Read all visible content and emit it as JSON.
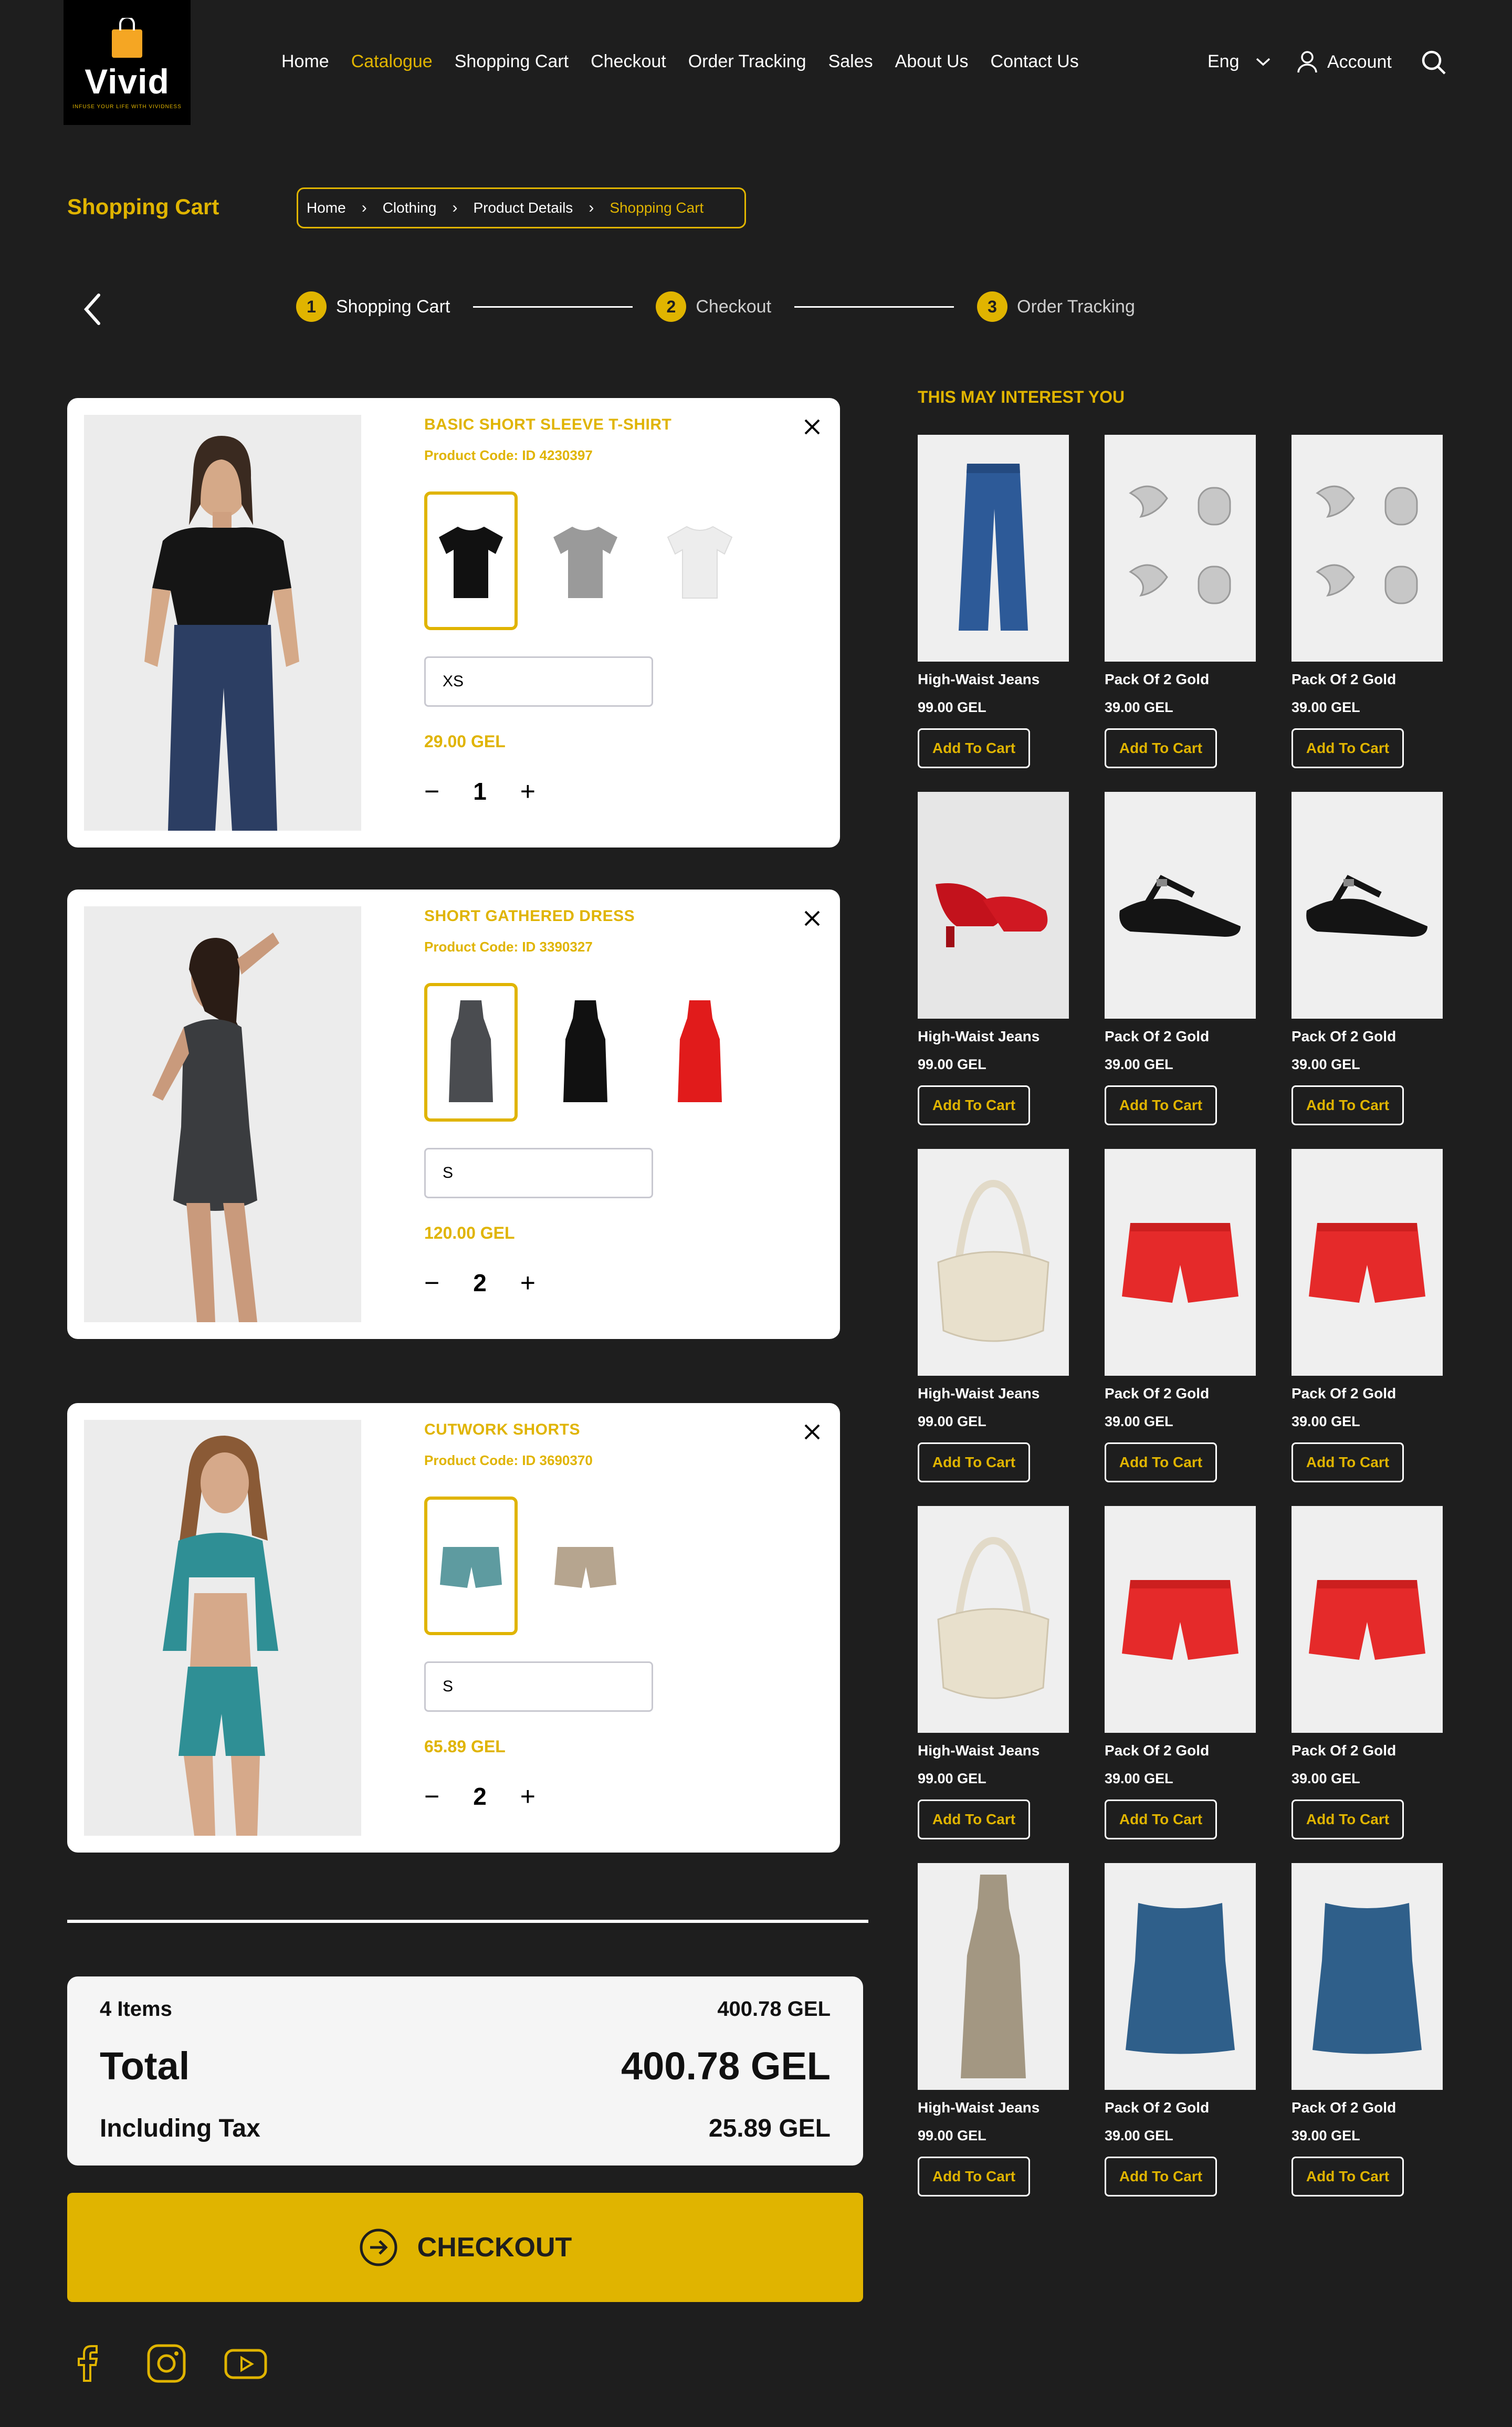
{
  "brand": {
    "name": "Vivid",
    "tagline": "INFUSE YOUR LIFE WITH VIVIDNESS"
  },
  "nav": [
    "Home",
    "Catalogue",
    "Shopping Cart",
    "Checkout",
    "Order Tracking",
    "Sales",
    "About Us",
    "Contact Us"
  ],
  "nav_active": "Catalogue",
  "header": {
    "language": "Eng",
    "account": "Account"
  },
  "page": {
    "title": "Shopping Cart"
  },
  "breadcrumb": [
    "Home",
    "Clothing",
    "Product Details",
    "Shopping Cart"
  ],
  "steps": [
    {
      "num": "1",
      "label": "Shopping Cart"
    },
    {
      "num": "2",
      "label": "Checkout"
    },
    {
      "num": "3",
      "label": "Order Tracking"
    }
  ],
  "cart": [
    {
      "name": "BASIC SHORT SLEEVE T-SHIRT",
      "code": "Product Code: ID 4230397",
      "size": "XS",
      "price": "29.00 GEL",
      "qty": "1"
    },
    {
      "name": "SHORT GATHERED DRESS",
      "code": "Product Code: ID 3390327",
      "size": "S",
      "price": "120.00 GEL",
      "qty": "2"
    },
    {
      "name": "CUTWORK SHORTS",
      "code": "Product Code: ID 3690370",
      "size": "S",
      "price": "65.89 GEL",
      "qty": "2"
    }
  ],
  "summary": {
    "items_label": "4 Items",
    "items_value": "400.78 GEL",
    "total_label": "Total",
    "total_value": "400.78 GEL",
    "tax_label": "Including Tax",
    "tax_value": "25.89 GEL"
  },
  "checkout_label": "CHECKOUT",
  "recommend": {
    "title": "THIS MAY INTEREST YOU",
    "add_label": "Add To Cart",
    "items": [
      {
        "title": "High-Waist Jeans",
        "price": "99.00 GEL"
      },
      {
        "title": "Pack Of 2 Gold",
        "price": "39.00 GEL"
      },
      {
        "title": "Pack Of 2 Gold",
        "price": "39.00 GEL"
      },
      {
        "title": "High-Waist Jeans",
        "price": "99.00 GEL"
      },
      {
        "title": "Pack Of 2 Gold",
        "price": "39.00 GEL"
      },
      {
        "title": "Pack Of 2 Gold",
        "price": "39.00 GEL"
      },
      {
        "title": "High-Waist Jeans",
        "price": "99.00 GEL"
      },
      {
        "title": "Pack Of 2 Gold",
        "price": "39.00 GEL"
      },
      {
        "title": "Pack Of 2 Gold",
        "price": "39.00 GEL"
      },
      {
        "title": "High-Waist Jeans",
        "price": "99.00 GEL"
      },
      {
        "title": "Pack Of 2 Gold",
        "price": "39.00 GEL"
      },
      {
        "title": "Pack Of 2 Gold",
        "price": "39.00 GEL"
      },
      {
        "title": "High-Waist Jeans",
        "price": "99.00 GEL"
      },
      {
        "title": "Pack Of 2 Gold",
        "price": "39.00 GEL"
      },
      {
        "title": "Pack Of 2 Gold",
        "price": "39.00 GEL"
      }
    ]
  },
  "colors": {
    "accent": "#e0b400",
    "background": "#1e1e1e",
    "card": "#ffffff"
  }
}
